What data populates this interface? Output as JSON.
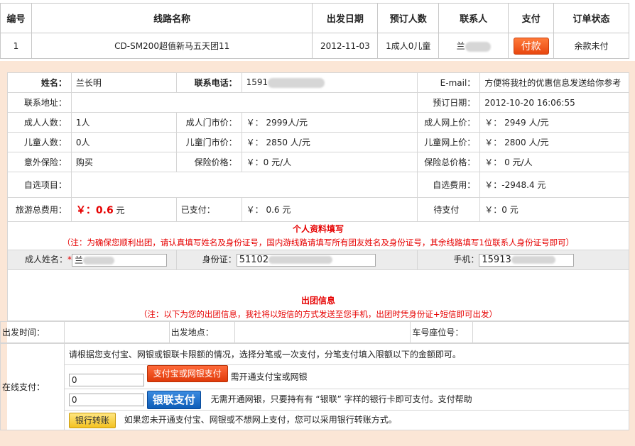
{
  "order_table": {
    "headers": [
      "编号",
      "线路名称",
      "出发日期",
      "预订人数",
      "联系人",
      "支付",
      "订单状态"
    ],
    "row": {
      "id": "1",
      "route": "CD-SM200超值新马五天团11",
      "date": "2012-11-03",
      "people": "1成人0儿童",
      "contact": "兰",
      "pay_label": "付款",
      "status": "余款未付"
    }
  },
  "info": {
    "name_label": "姓名：",
    "name": "兰长明",
    "phone_label": "联系电话：",
    "phone": "1591",
    "email_label": "E-mail：",
    "email_note": "方便将我社的优惠信息发送给你参考",
    "address_label": "联系地址：",
    "book_date_label": "预订日期：",
    "book_date": "2012-10-20 16:06:55",
    "adult_count_label": "成人人数：",
    "adult_count": "1人",
    "adult_door_label": "成人门市价：",
    "adult_door": "￥： 2999人/元",
    "adult_net_label": "成人网上价：",
    "adult_net": "￥： 2949 人/元",
    "child_count_label": "儿童人数：",
    "child_count": "0人",
    "child_door_label": "儿童门市价：",
    "child_door": "￥： 2850 人/元",
    "child_net_label": "儿童网上价：",
    "child_net": "￥： 2800 人/元",
    "insurance_label": "意外保险：",
    "insurance": "购买",
    "insurance_price_label": "保险价格：",
    "insurance_price": "￥：0 元/人",
    "insurance_total_label": "保险总价格：",
    "insurance_total": "￥： 0 元/人",
    "option_label": "自选项目：",
    "option_fee_label": "自选费用：",
    "option_fee": "￥：-2948.4 元",
    "total_label": "旅游总费用：",
    "total_amount": "￥：0.6",
    "total_unit": "元",
    "paid_label": "已支付：",
    "paid": "￥： 0.6  元",
    "due_label": "待支付",
    "due": "￥：0  元"
  },
  "personal": {
    "title": "个人资料填写",
    "note": "（注：为确保您顺利出团，请认真填写姓名及身份证号，国内游线路请填写所有团友姓名及身份证号，其余线路填写1位联系人身份证号即可）",
    "adult_name_label": "成人姓名：",
    "required_mark": "*",
    "adult_name_value": "兰",
    "id_label": "身份证：",
    "id_value": "51102",
    "mobile_label": "手机：",
    "mobile_value": "15913"
  },
  "departure": {
    "title": "出团信息",
    "note": "（注：以下为您的出团信息，我社将以短信的方式发送至您手机，出团时凭身份证+短信即可出发）",
    "time_label": "出发时间：",
    "place_label": "出发地点：",
    "seat_label": "车号座位号："
  },
  "payment": {
    "label": "在线支付：",
    "instruction": "请根据您支付宝、网银或银联卡限额的情况，选择分笔或一次支付，分笔支付填入限额以下的金额即可。",
    "alipay_amount": "0",
    "alipay_button": "支付宝或网银支付",
    "alipay_note": "需开通支付宝或网银",
    "unionpay_amount": "0",
    "unionpay_button": "银联支付",
    "unionpay_note": "无需开通网银，只要持有有 “银联” 字样的银行卡即可支付。支付帮助",
    "transfer_button": "银行转账",
    "transfer_note": "如果您未开通支付宝、网银或不想网上支付，您可以采用银行转账方式。"
  }
}
